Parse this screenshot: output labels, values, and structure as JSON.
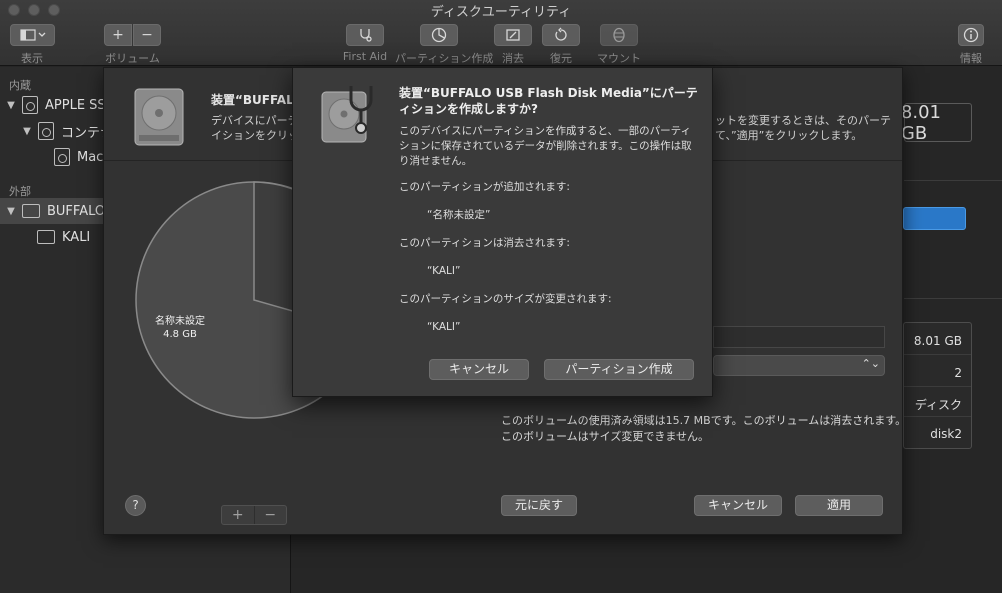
{
  "window": {
    "title": "ディスクユーティリティ"
  },
  "toolbar": {
    "view_label": "表示",
    "volume_label": "ボリューム",
    "first_aid_label": "First Aid",
    "partition_label": "パーティション作成",
    "erase_label": "消去",
    "restore_label": "復元",
    "mount_label": "マウント",
    "info_label": "情報",
    "add_symbol": "+",
    "remove_symbol": "−"
  },
  "sidebar": {
    "internal_header": "内蔵",
    "external_header": "外部",
    "items": [
      {
        "label": "APPLE SSD"
      },
      {
        "label": "コンテナ"
      },
      {
        "label": "Macintosh HD"
      },
      {
        "label": "BUFFALO USB Flash Disk Media"
      },
      {
        "label": "KALI"
      }
    ]
  },
  "main": {
    "capacity_text": "8.01 GB",
    "info_values": [
      "8.01 GB",
      "2",
      "ディスク",
      "disk2"
    ]
  },
  "sheet": {
    "title": "装置“BUFFALO",
    "desc_left": "デバイスにパーティションを作成\nイションをクリック",
    "desc_right": "ットを変更するときは、そのパーテ\nて、”適用”をクリックします。",
    "pie": {
      "label_name": "名称未設定",
      "label_size": "4.8 GB"
    },
    "add_symbol": "+",
    "remove_symbol": "−",
    "volume_note_1": "このボリュームの使用済み領域は15.7 MBです。このボリュームは消去されます。",
    "volume_note_2": "このボリュームはサイズ変更できません。",
    "help_label": "?",
    "revert_label": "元に戻す",
    "cancel_label": "キャンセル",
    "apply_label": "適用"
  },
  "alert": {
    "title": "装置“BUFFALO USB Flash Disk Media”にパーティションを作成しますか?",
    "message": "このデバイスにパーティションを作成すると、一部のパーティションに保存されているデータが削除されます。この操作は取り消せません。",
    "added_header": "このパーティションが追加されます:",
    "added_item": "“名称未設定”",
    "erased_header": "このパーティションは消去されます:",
    "erased_item": "“KALI”",
    "resized_header": "このパーティションのサイズが変更されます:",
    "resized_item": "“KALI”",
    "cancel_label": "キャンセル",
    "confirm_label": "パーティション作成"
  }
}
